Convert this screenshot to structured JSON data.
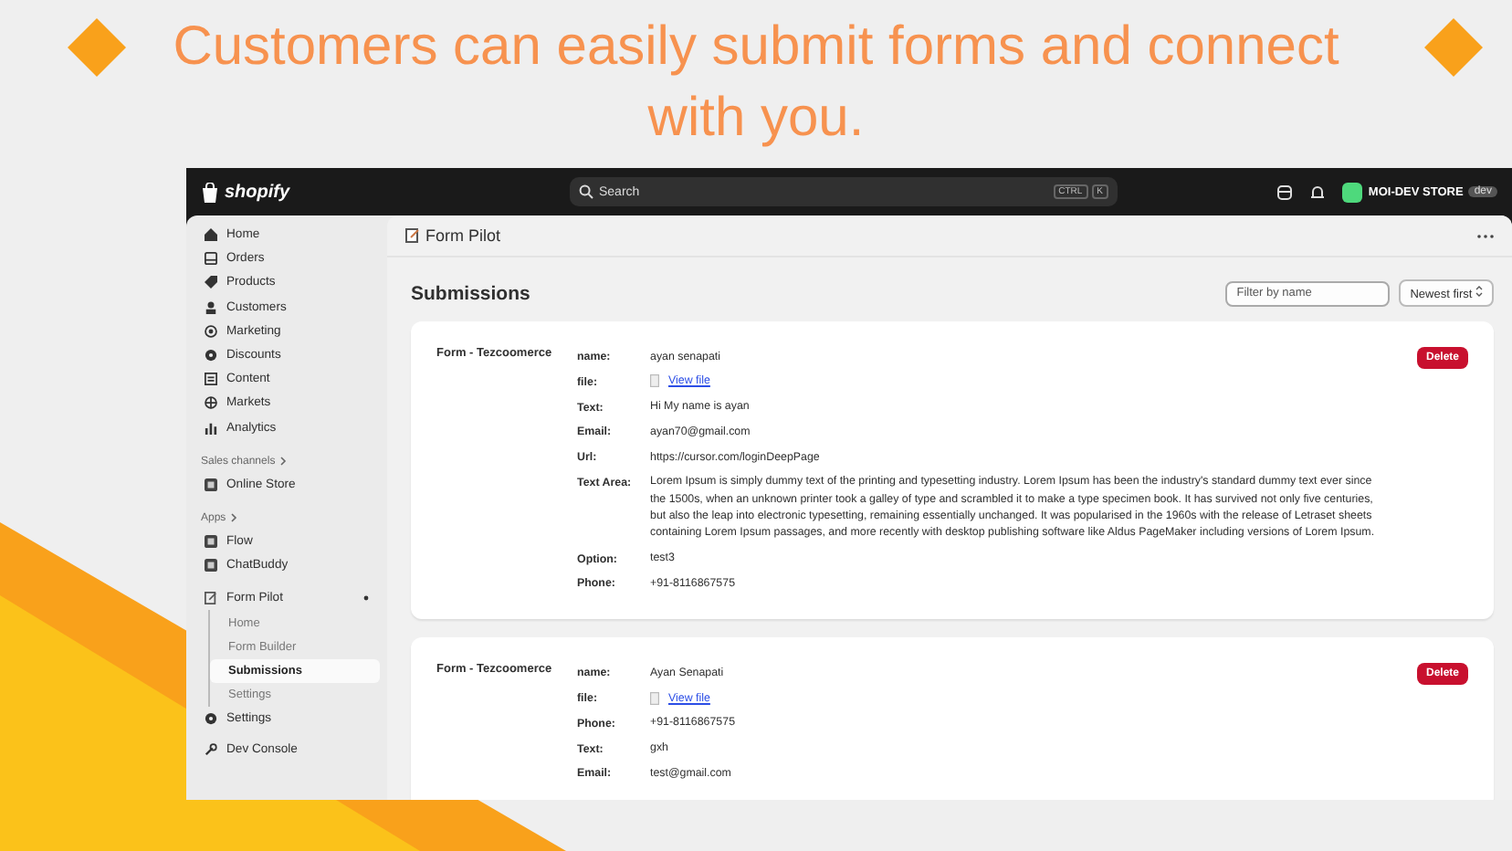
{
  "headline": [
    "Customers can easily submit forms and connect",
    "with you."
  ],
  "topbar": {
    "logo": "shopify",
    "search": {
      "placeholder": "Search"
    },
    "keys": [
      "CTRL",
      "K"
    ],
    "store": "MOI-DEV STORE",
    "badge": "dev"
  },
  "sidebar": {
    "main": [
      {
        "label": "Home",
        "selected": false
      },
      {
        "label": "Orders",
        "selected": false
      },
      {
        "label": "Products",
        "selected": false
      },
      {
        "label": "Customers",
        "selected": false
      },
      {
        "label": "Marketing",
        "selected": false
      },
      {
        "label": "Discounts",
        "selected": false
      },
      {
        "label": "Content",
        "selected": false
      },
      {
        "label": "Markets",
        "selected": false
      },
      {
        "label": "Analytics",
        "selected": false
      }
    ],
    "sections": [
      {
        "title": "Sales channels",
        "items": [
          {
            "label": "Online Store",
            "selected": false
          }
        ]
      },
      {
        "title": "Apps",
        "items": [
          {
            "label": "Flow",
            "selected": false
          },
          {
            "label": "ChatBuddy",
            "selected": false
          }
        ]
      }
    ],
    "app": {
      "label": "Form Pilot",
      "expanded": true,
      "children": [
        {
          "label": "Home",
          "selected": false
        },
        {
          "label": "Form Builder",
          "selected": false
        },
        {
          "label": "Submissions",
          "selected": true
        },
        {
          "label": "Settings",
          "selected": false
        }
      ]
    },
    "bottom": [
      {
        "label": "Settings",
        "selected": false
      },
      {
        "label": "Dev Console",
        "selected": false
      }
    ]
  },
  "page": {
    "app_title": "Form Pilot",
    "title": "Submissions",
    "filter": {
      "placeholder": "Filter by name"
    },
    "sort": "Newest first"
  },
  "submissions": [
    {
      "form": "Form - Tezcoomerce",
      "delete": "Delete",
      "fields": [
        {
          "label": "name:",
          "value": "ayan senapati",
          "kind": "text"
        },
        {
          "label": "file:",
          "value": "View file",
          "kind": "file"
        },
        {
          "label": "Text:",
          "value": "Hi My name is ayan",
          "kind": "text"
        },
        {
          "label": "Email:",
          "value": "ayan70@gmail.com",
          "kind": "text"
        },
        {
          "label": "Url:",
          "value": "https://cursor.com/loginDeepPage",
          "kind": "text"
        },
        {
          "label": "Text Area:",
          "value": "Lorem Ipsum is simply dummy text of the printing and typesetting industry. Lorem Ipsum has been the industry's standard dummy text ever since the 1500s, when an unknown printer took a galley of type and scrambled it to make a type specimen book. It has survived not only five centuries, but also the leap into electronic typesetting, remaining essentially unchanged. It was popularised in the 1960s with the release of Letraset sheets containing Lorem Ipsum passages, and more recently with desktop publishing software like Aldus PageMaker including versions of Lorem Ipsum.",
          "kind": "text"
        },
        {
          "label": "Option:",
          "value": "test3",
          "kind": "text"
        },
        {
          "label": "Phone:",
          "value": "+91-8116867575",
          "kind": "text"
        }
      ]
    },
    {
      "form": "Form - Tezcoomerce",
      "delete": "Delete",
      "fields": [
        {
          "label": "name:",
          "value": "Ayan Senapati",
          "kind": "text"
        },
        {
          "label": "file:",
          "value": "View file",
          "kind": "file"
        },
        {
          "label": "Phone:",
          "value": "+91-8116867575",
          "kind": "text"
        },
        {
          "label": "Text:",
          "value": "gxh",
          "kind": "text"
        },
        {
          "label": "Email:",
          "value": "test@gmail.com",
          "kind": "text"
        }
      ]
    }
  ]
}
